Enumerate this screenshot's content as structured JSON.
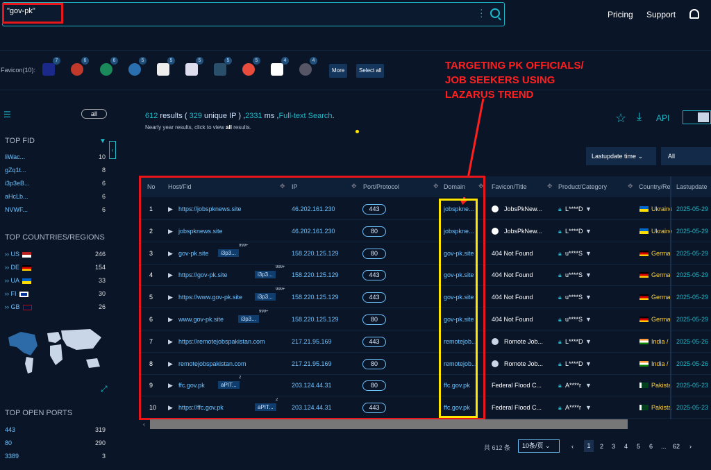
{
  "search": {
    "query": "\"gov-pk\""
  },
  "nav": {
    "pricing": "Pricing",
    "support": "Support"
  },
  "favicons": {
    "label": "Favicon(10):",
    "counts": [
      "7",
      "6",
      "6",
      "5",
      "5",
      "5",
      "5",
      "5",
      "4",
      "4"
    ],
    "more": "More",
    "select_all": "Select all"
  },
  "annotation": {
    "line1": "TARGETING PK OFFICIALS/",
    "line2": "JOB SEEKERS USING",
    "line3": "LAZARUS TREND"
  },
  "filter_all": "all",
  "top_fid": {
    "title": "TOP FID",
    "items": [
      {
        "label": "liWac...",
        "count": "10"
      },
      {
        "label": "gZq1t...",
        "count": "8"
      },
      {
        "label": "i3p3eB...",
        "count": "6"
      },
      {
        "label": "aHcLb...",
        "count": "6"
      },
      {
        "label": "NVWF...",
        "count": "6"
      }
    ]
  },
  "top_countries": {
    "title": "TOP COUNTRIES/REGIONS",
    "items": [
      {
        "label": "US",
        "count": "246"
      },
      {
        "label": "DE",
        "count": "154"
      },
      {
        "label": "UA",
        "count": "33"
      },
      {
        "label": "FI",
        "count": "30"
      },
      {
        "label": "GB",
        "count": "26"
      }
    ]
  },
  "top_ports": {
    "title": "TOP OPEN PORTS",
    "items": [
      {
        "label": "443",
        "count": "319"
      },
      {
        "label": "80",
        "count": "290"
      },
      {
        "label": "3389",
        "count": "3"
      }
    ]
  },
  "results": {
    "count": "612",
    "t1": " results ( ",
    "unique": "329",
    "t2": " unique IP ) ,",
    "ms": "2331",
    "t3": " ms ,",
    "fulltext": "Full-text Search",
    "t4": ".",
    "sub1": "Nearly year results, click to view ",
    "sub_all": "all",
    "sub2": " results."
  },
  "toolbar": {
    "api": "API",
    "sort": "Lastupdate time",
    "filter": "All"
  },
  "table": {
    "headers": {
      "no": "No",
      "host": "Host/Fid",
      "ip": "IP",
      "port": "Port/Protocol",
      "domain": "Domain",
      "title": "Favicon/Title",
      "product": "Product/Category",
      "country": "Country/Re",
      "updated": "Lastupdate"
    },
    "rows": [
      {
        "no": "1",
        "host": "https://jobspknews.site",
        "tag": "",
        "sup": "",
        "ip": "46.202.161.230",
        "port": "443",
        "domain": "jobspkne...",
        "title": "JobsPkNew...",
        "product": "L****D",
        "country": "Ukraine",
        "date": "2025-05-29"
      },
      {
        "no": "2",
        "host": "jobspknews.site",
        "tag": "",
        "sup": "",
        "ip": "46.202.161.230",
        "port": "80",
        "domain": "jobspkne...",
        "title": "JobsPkNew...",
        "product": "L****D",
        "country": "Ukraine",
        "date": "2025-05-29"
      },
      {
        "no": "3",
        "host": "gov-pk.site",
        "tag": "i3p3...",
        "sup": "999+",
        "ip": "158.220.125.129",
        "port": "80",
        "domain": "gov-pk.site",
        "title": "404 Not Found",
        "product": "u****S",
        "country": "Germa",
        "date": "2025-05-29"
      },
      {
        "no": "4",
        "host": "https://gov-pk.site",
        "tag": "i3p3...",
        "sup": "999+",
        "ip": "158.220.125.129",
        "port": "443",
        "domain": "gov-pk.site",
        "title": "404 Not Found",
        "product": "u****S",
        "country": "Germa",
        "date": "2025-05-29"
      },
      {
        "no": "5",
        "host": "https://www.gov-pk.site",
        "tag": "i3p3...",
        "sup": "999+",
        "ip": "158.220.125.129",
        "port": "443",
        "domain": "gov-pk.site",
        "title": "404 Not Found",
        "product": "u****S",
        "country": "Germa",
        "date": "2025-05-29"
      },
      {
        "no": "6",
        "host": "www.gov-pk.site",
        "tag": "i3p3...",
        "sup": "999+",
        "ip": "158.220.125.129",
        "port": "80",
        "domain": "gov-pk.site",
        "title": "404 Not Found",
        "product": "u****S",
        "country": "Germa",
        "date": "2025-05-29"
      },
      {
        "no": "7",
        "host": "https://remotejobspakistan.com",
        "tag": "",
        "sup": "",
        "ip": "217.21.95.169",
        "port": "443",
        "domain": "remotejob...",
        "title": "Romote Job...",
        "product": "L****D",
        "country": "India /",
        "date": "2025-05-26"
      },
      {
        "no": "8",
        "host": "remotejobspakistan.com",
        "tag": "",
        "sup": "",
        "ip": "217.21.95.169",
        "port": "80",
        "domain": "remotejob...",
        "title": "Romote Job...",
        "product": "L****D",
        "country": "India /",
        "date": "2025-05-26"
      },
      {
        "no": "9",
        "host": "ffc.gov.pk",
        "tag": "aPIT...",
        "sup": "2",
        "ip": "203.124.44.31",
        "port": "80",
        "domain": "ffc.gov.pk",
        "title": "Federal Flood C...",
        "product": "A****r",
        "country": "Pakista",
        "date": "2025-05-23"
      },
      {
        "no": "10",
        "host": "https://ffc.gov.pk",
        "tag": "aPIT...",
        "sup": "2",
        "ip": "203.124.44.31",
        "port": "443",
        "domain": "ffc.gov.pk",
        "title": "Federal Flood C...",
        "product": "A****r",
        "country": "Pakista",
        "date": "2025-05-23"
      }
    ]
  },
  "pager": {
    "total": "共 612 条",
    "size": "10条/页",
    "pages": [
      "1",
      "2",
      "3",
      "4",
      "5",
      "6",
      "...",
      "62"
    ]
  }
}
